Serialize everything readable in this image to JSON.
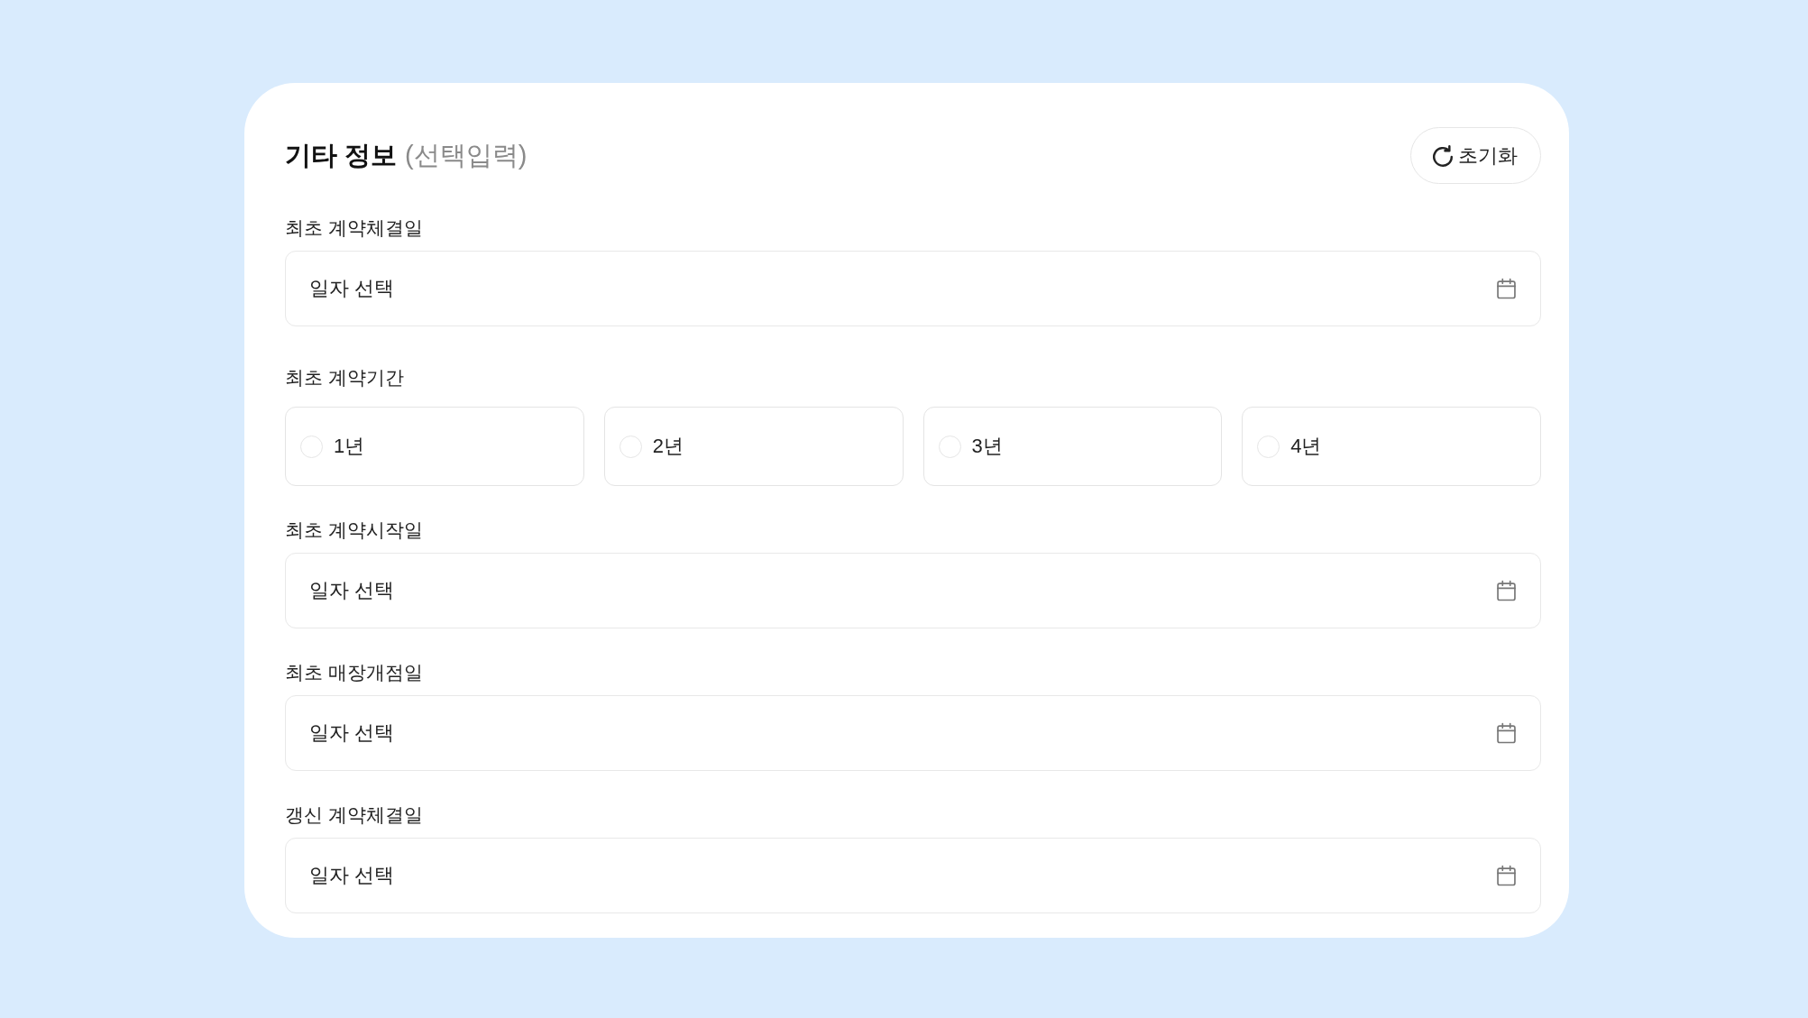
{
  "header": {
    "title": "기타 정보",
    "subtitle": "(선택입력)",
    "reset_button": {
      "label": "초기화"
    }
  },
  "fields": [
    {
      "kind": "date",
      "label": "최초 계약체결일",
      "placeholder": "일자 선택"
    },
    {
      "kind": "radio",
      "label": "최초 계약기간",
      "options": [
        {
          "label": "1년",
          "selected": false
        },
        {
          "label": "2년",
          "selected": false
        },
        {
          "label": "3년",
          "selected": false
        },
        {
          "label": "4년",
          "selected": false
        }
      ]
    },
    {
      "kind": "date",
      "label": "최초 계약시작일",
      "placeholder": "일자 선택"
    },
    {
      "kind": "date",
      "label": "최초 매장개점일",
      "placeholder": "일자 선택"
    },
    {
      "kind": "date",
      "label": "갱신 계약체결일",
      "placeholder": "일자 선택"
    }
  ]
}
